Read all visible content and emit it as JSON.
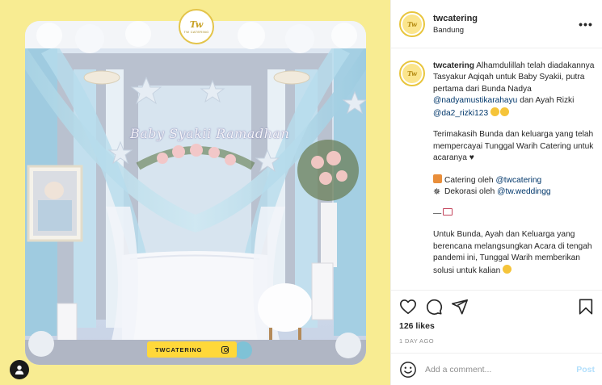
{
  "post_image": {
    "banner_text": "Baby Syakii Ramadhan",
    "logo_text": "Tw",
    "logo_subtext": "TW CATERING",
    "brand_label": "TWCATERING"
  },
  "header": {
    "username": "twcatering",
    "location": "Bandung",
    "more_label": "•••"
  },
  "caption": {
    "username": "twcatering",
    "p1_text": "Alhamdulillah telah diadakannya Tasyakur Aqiqah untuk Baby Syakii, putra pertama dari Bunda Nadya",
    "p1_mention1": "@nadyamustikarahayu",
    "p1_mid": "dan Ayah Rizki",
    "p1_mention2": "@da2_rizki123",
    "p2_text": "Terimakasih Bunda dan keluarga yang telah mempercayai Tunggal Warih Catering untuk acaranya",
    "p2_heart": "♥",
    "line_catering": "Catering oleh",
    "mention_catering": "@twcatering",
    "line_dekor": "Dekorasi oleh",
    "mention_dekor": "@tw.weddingg",
    "dash": "—",
    "p4_text": "Untuk Bunda, Ayah dan Keluarga yang berencana melangsungkan Acara di tengah pandemi ini, Tunggal Warih memberikan solusi untuk kalian"
  },
  "stats": {
    "likes": "126 likes",
    "time": "1 DAY AGO"
  },
  "comment_box": {
    "placeholder": "Add a comment...",
    "post_label": "Post"
  },
  "colors": {
    "page_bg": "#f8ec92",
    "brand_yellow": "#ffd83a",
    "mention": "#00376b",
    "post_disabled": "#b2dffc"
  },
  "icons": [
    "heart-icon",
    "comment-icon",
    "share-icon",
    "bookmark-icon",
    "smiley-icon",
    "user-tag-icon",
    "more-icon",
    "instagram-icon"
  ]
}
